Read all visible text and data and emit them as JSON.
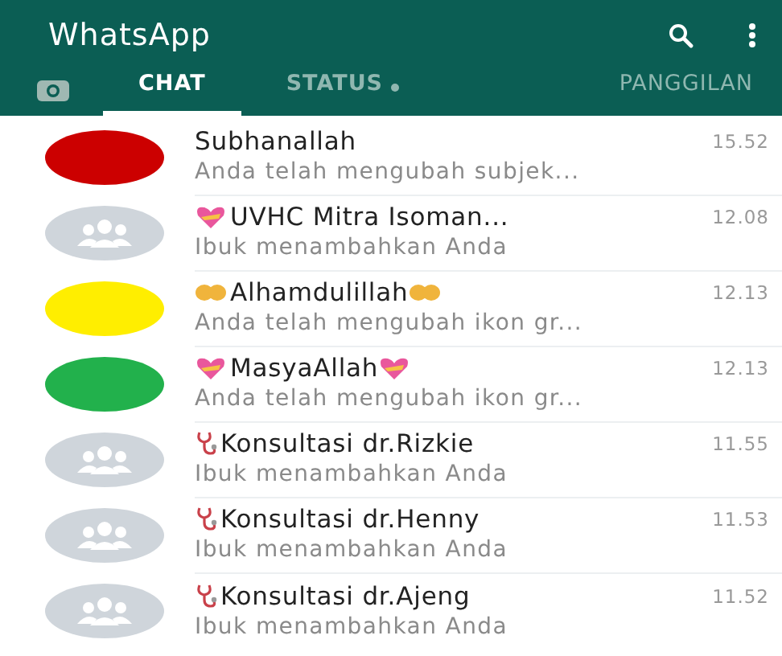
{
  "app_bar": {
    "title": "WhatsApp"
  },
  "tabs": [
    {
      "label": "CHAT",
      "selected": true,
      "new_dot": false
    },
    {
      "label": "STATUS",
      "selected": false,
      "new_dot": true
    },
    {
      "label": "PANGGILAN",
      "selected": false,
      "new_dot": false
    }
  ],
  "chats": [
    {
      "name": "Subhanallah",
      "time": "15.52",
      "message": "Anda telah mengubah subjek...",
      "color": "#cc0000",
      "kind": "plain"
    },
    {
      "name": "UVHC Mitra Isoman...",
      "time": "12.08",
      "message": "Ibuk menambahkan Anda",
      "kind": "heart"
    },
    {
      "name": "Alhamdulillah",
      "time": "12.13",
      "message": "Anda telah mengubah ikon gr...",
      "color": "#ffee00",
      "kind": "hands"
    },
    {
      "name": "MasyaAllah",
      "time": "12.13",
      "message": "Anda telah mengubah ikon gr...",
      "color": "#22b14c",
      "kind": "heart"
    },
    {
      "name": "Konsultasi dr.Rizkie",
      "time": "11.55",
      "message": "Ibuk menambahkan Anda",
      "kind": "stethoscope"
    },
    {
      "name": "Konsultasi dr.Henny",
      "time": "11.53",
      "message": "Ibuk menambahkan Anda",
      "kind": "stethoscope"
    },
    {
      "name": "Konsultasi dr.Ajeng",
      "time": "11.52",
      "message": "Ibuk menambahkan Anda",
      "kind": "stethoscope"
    }
  ]
}
